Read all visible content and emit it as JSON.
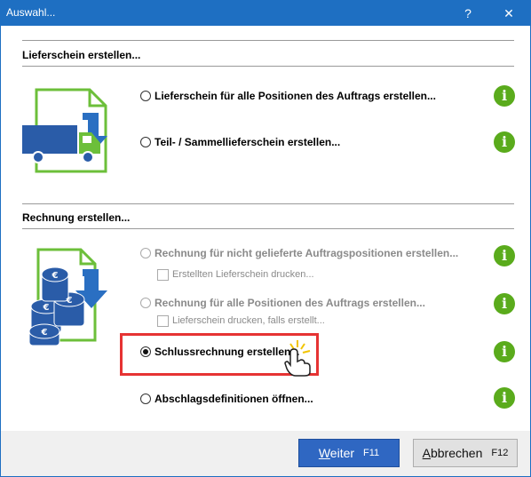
{
  "window": {
    "title": "Auswahl...",
    "help": "?",
    "close": "✕"
  },
  "lieferschein": {
    "heading": "Lieferschein erstellen...",
    "options": [
      {
        "label": "Lieferschein für alle Positionen des Auftrags erstellen..."
      },
      {
        "label": "Teil- / Sammellieferschein erstellen..."
      }
    ]
  },
  "rechnung": {
    "heading": "Rechnung erstellen...",
    "options": [
      {
        "label": "Rechnung für nicht gelieferte Auftragspositionen erstellen...",
        "checkbox": "Erstellten Lieferschein drucken..."
      },
      {
        "label": "Rechnung für alle Positionen des Auftrags erstellen...",
        "checkbox": "Lieferschein drucken, falls erstellt..."
      },
      {
        "label": "Schlussrechnung erstellen...",
        "selected": true
      },
      {
        "label": "Abschlagsdefinitionen öffnen..."
      }
    ]
  },
  "info_glyph": "i",
  "footer": {
    "next_label": "Weiter",
    "next_key": "F11",
    "cancel_label": "Abbrechen",
    "cancel_key": "F12"
  },
  "colors": {
    "titlebar": "#1e6fc2",
    "accent": "#2f67c2",
    "info": "#5aab1c",
    "highlight": "#e63333",
    "truck": "#2a5ca8",
    "doc": "#6cbf3a"
  }
}
